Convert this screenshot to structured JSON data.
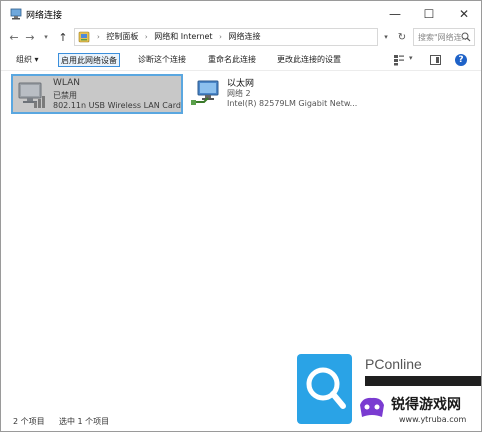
{
  "window": {
    "title": "网络连接",
    "min_glyph": "—",
    "max_glyph": "☐",
    "close_glyph": "✕"
  },
  "address": {
    "back_glyph": "←",
    "forward_glyph": "→",
    "history_glyph": "▾",
    "up_glyph": "↑",
    "breadcrumbs": [
      "控制面板",
      "网络和 Internet",
      "网络连接"
    ],
    "separator": "›",
    "dropdown_glyph": "▾",
    "refresh_glyph": "↻",
    "search_placeholder": "搜索\"网络连..."
  },
  "toolbar": {
    "organize": "组织 ▾",
    "enable": "启用此网络设备",
    "diagnose": "诊断这个连接",
    "rename": "重命名此连接",
    "change_settings": "更改此连接的设置",
    "view_dropdown": "▾",
    "help": "?"
  },
  "connections": [
    {
      "name": "WLAN",
      "status": "已禁用",
      "device": "802.11n USB Wireless LAN Card",
      "icon": "wifi-adapter-icon",
      "selected": true
    },
    {
      "name": "以太网",
      "status": "网络 2",
      "device": "Intel(R) 82579LM Gigabit Netw...",
      "icon": "ethernet-adapter-icon",
      "selected": false
    }
  ],
  "statusbar": {
    "item_count": "2 个项目",
    "selected_count": "选中 1 个项目"
  },
  "watermarks": {
    "pconline": "PConline",
    "ytruba_name": "锐得游戏网",
    "ytruba_url": "www.ytruba.com"
  },
  "colors": {
    "accent": "#3b8fdc",
    "selection_bg": "#c8c8c8",
    "help_blue": "#1e62c8"
  }
}
